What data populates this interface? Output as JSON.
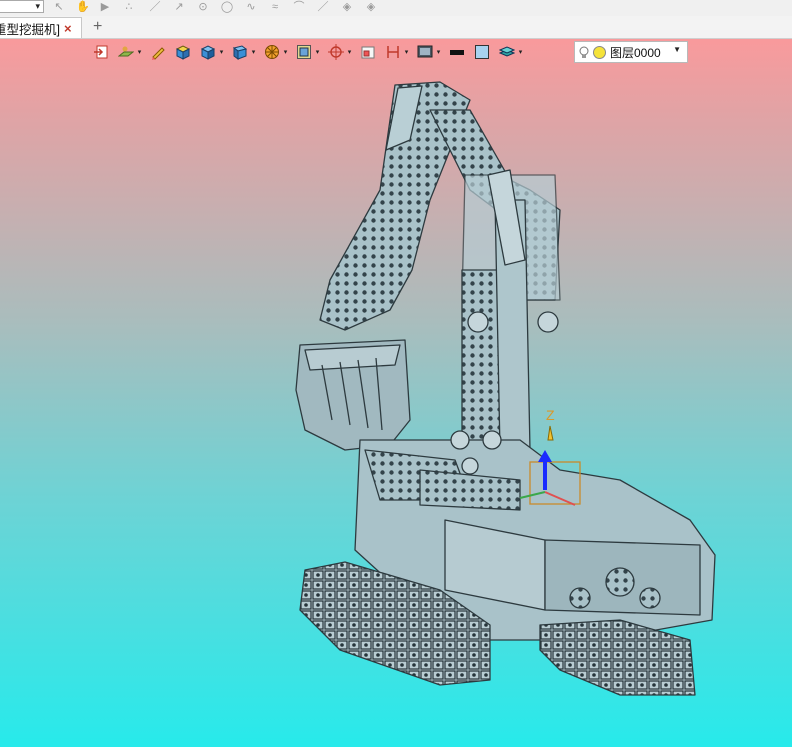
{
  "document_tab": {
    "label": "[重型挖掘机]",
    "close_icon": "×"
  },
  "new_tab_label": "+",
  "layer": {
    "name": "图层0000"
  },
  "axis_label": "Z",
  "colors": {
    "viewport_top": "#f99a9c",
    "viewport_bottom": "#27eaeb",
    "model_fill": "#a9c2c9",
    "model_stroke": "#2d3a3f",
    "axis_arrow": "#1a2bff"
  },
  "toolbar_icons": [
    "import-icon",
    "sketch-plane-icon",
    "pencil-icon",
    "solid-box-icon",
    "render-box-icon",
    "view-orient-icon",
    "wheel-icon",
    "frame-icon",
    "snap-target-icon",
    "clip-icon",
    "dimension-icon",
    "display-mode-icon",
    "line-color-swatch",
    "fill-color-swatch",
    "layer-stack-icon"
  ]
}
